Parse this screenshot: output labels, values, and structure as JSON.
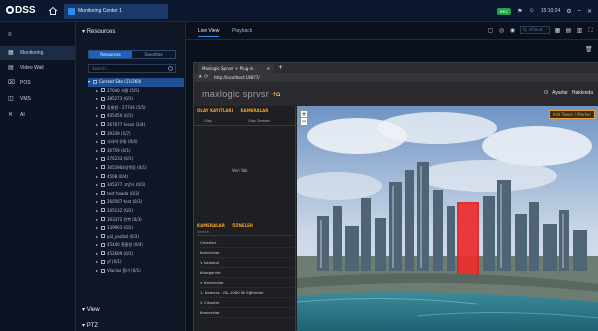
{
  "topbar": {
    "logo": "DSS",
    "tab_label": "Monitoring Center 1",
    "status": "REC",
    "clock": "15:10:24",
    "icons": [
      "home-icon",
      "bell-icon",
      "user-icon",
      "settings-icon",
      "minimize-icon",
      "close-icon"
    ]
  },
  "leftnav": {
    "items": [
      {
        "icon": "≡",
        "label": ""
      },
      {
        "icon": "▦",
        "label": "Monitoring"
      },
      {
        "icon": "▤",
        "label": "Video Wall"
      },
      {
        "icon": "⌧",
        "label": "POS"
      },
      {
        "icon": "◫",
        "label": "VMS"
      },
      {
        "icon": "✕",
        "label": "AI"
      }
    ]
  },
  "resources": {
    "title": "Resources",
    "tabs": [
      "Resources",
      "Favorites"
    ],
    "search_placeholder": "Search...",
    "tree": [
      {
        "label": "Current Site (11/260)",
        "root": true
      },
      {
        "label": "27640 서울 (5/5)"
      },
      {
        "label": "285273 (0/1)"
      },
      {
        "label": "동물원 - 27744 (5/5)"
      },
      {
        "label": "405450 (0/1)"
      },
      {
        "label": "267677 Insan (1/4)"
      },
      {
        "label": "39339 (5/7)"
      },
      {
        "label": "서서마 유통 (0/4)"
      },
      {
        "label": "30759 (0/1)"
      },
      {
        "label": "276233 (0/1)"
      },
      {
        "label": "3053904성북동 (0/1)"
      },
      {
        "label": "4508 (0/4)"
      },
      {
        "label": "345377 고양시 (0/3)"
      },
      {
        "label": "test hoada (0/3)"
      },
      {
        "label": "260567 test (0/3)"
      },
      {
        "label": "205132 (0/2)"
      },
      {
        "label": "363372 전북 (0/3)"
      },
      {
        "label": "339903 (0/2)"
      },
      {
        "label": "yal_yazilat (0/2)"
      },
      {
        "label": "45440 철물원 (0/4)"
      },
      {
        "label": "452609 (0/1)"
      },
      {
        "label": "yf (0/1)"
      },
      {
        "label": "Vlaclus 통녀 (0/1)"
      }
    ],
    "view_label": "View",
    "ptz_label": "PTZ"
  },
  "main": {
    "tabs": [
      "Live View",
      "Playback"
    ],
    "search_placeholder": "Q, vCloud"
  },
  "browser": {
    "tab_title": "Maxlogic Sprvsr + Plug-in",
    "url": "http://localhost:19877/"
  },
  "app": {
    "logo_main": "maxlogic sprvsr ",
    "logo_plus": "+",
    "user_label": "Ayarlar",
    "help_label": "Hakkında",
    "camera_tabs": [
      "OLAY KAYITLARI",
      "KAMERALAR"
    ],
    "camera_columns": [
      "Olay",
      "Olay Zamanı"
    ],
    "camera_empty": "Veri Yok",
    "category_tabs": [
      "KAMERALAR",
      "ÖZNELER"
    ],
    "category_search": "Search",
    "category_items": [
      "Cevizlier",
      "Kameralar",
      "∨ İstanbul",
      "Kategoriler",
      "∨ Kameralar",
      "1. Kamera - ML-1060 İlk Eğitimler",
      "∨ Cihazlar",
      "Kameralar"
    ],
    "add_tower_label": "Add Tower / Marker"
  },
  "colors": {
    "accent_blue": "#2d8cf0",
    "accent_orange": "#f0a030",
    "highlight_red": "#e02020"
  }
}
